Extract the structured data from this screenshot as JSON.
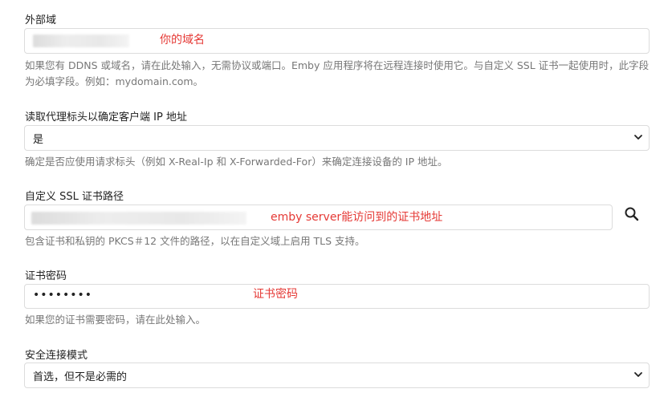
{
  "external_domain": {
    "label": "外部域",
    "annotation": "你的域名",
    "help": "如果您有 DDNS 或域名，请在此处输入，无需协议或端口。Emby 应用程序将在远程连接时使用它。与自定义 SSL 证书一起使用时，此字段为必填字段。例如：mydomain.com。"
  },
  "proxy_header": {
    "label": "读取代理标头以确定客户端 IP 地址",
    "selected": "是",
    "help": "确定是否应使用请求标头（例如 X-Real-Ip 和 X-Forwarded-For）来确定连接设备的 IP 地址。"
  },
  "ssl_cert_path": {
    "label": "自定义 SSL 证书路径",
    "annotation": "emby server能访问到的证书地址",
    "help": "包含证书和私钥的 PKCS＃12 文件的路径，以在自定义域上启用 TLS 支持。",
    "search_icon": "search-icon"
  },
  "cert_password": {
    "label": "证书密码",
    "value": "••••••••",
    "annotation": "证书密码",
    "help": "如果您的证书需要密码，请在此处输入。"
  },
  "secure_mode": {
    "label": "安全连接模式",
    "selected": "首选，但不是必需的"
  },
  "colors": {
    "annotation": "#e53935",
    "border": "#dcdcdc",
    "help": "#777777"
  }
}
